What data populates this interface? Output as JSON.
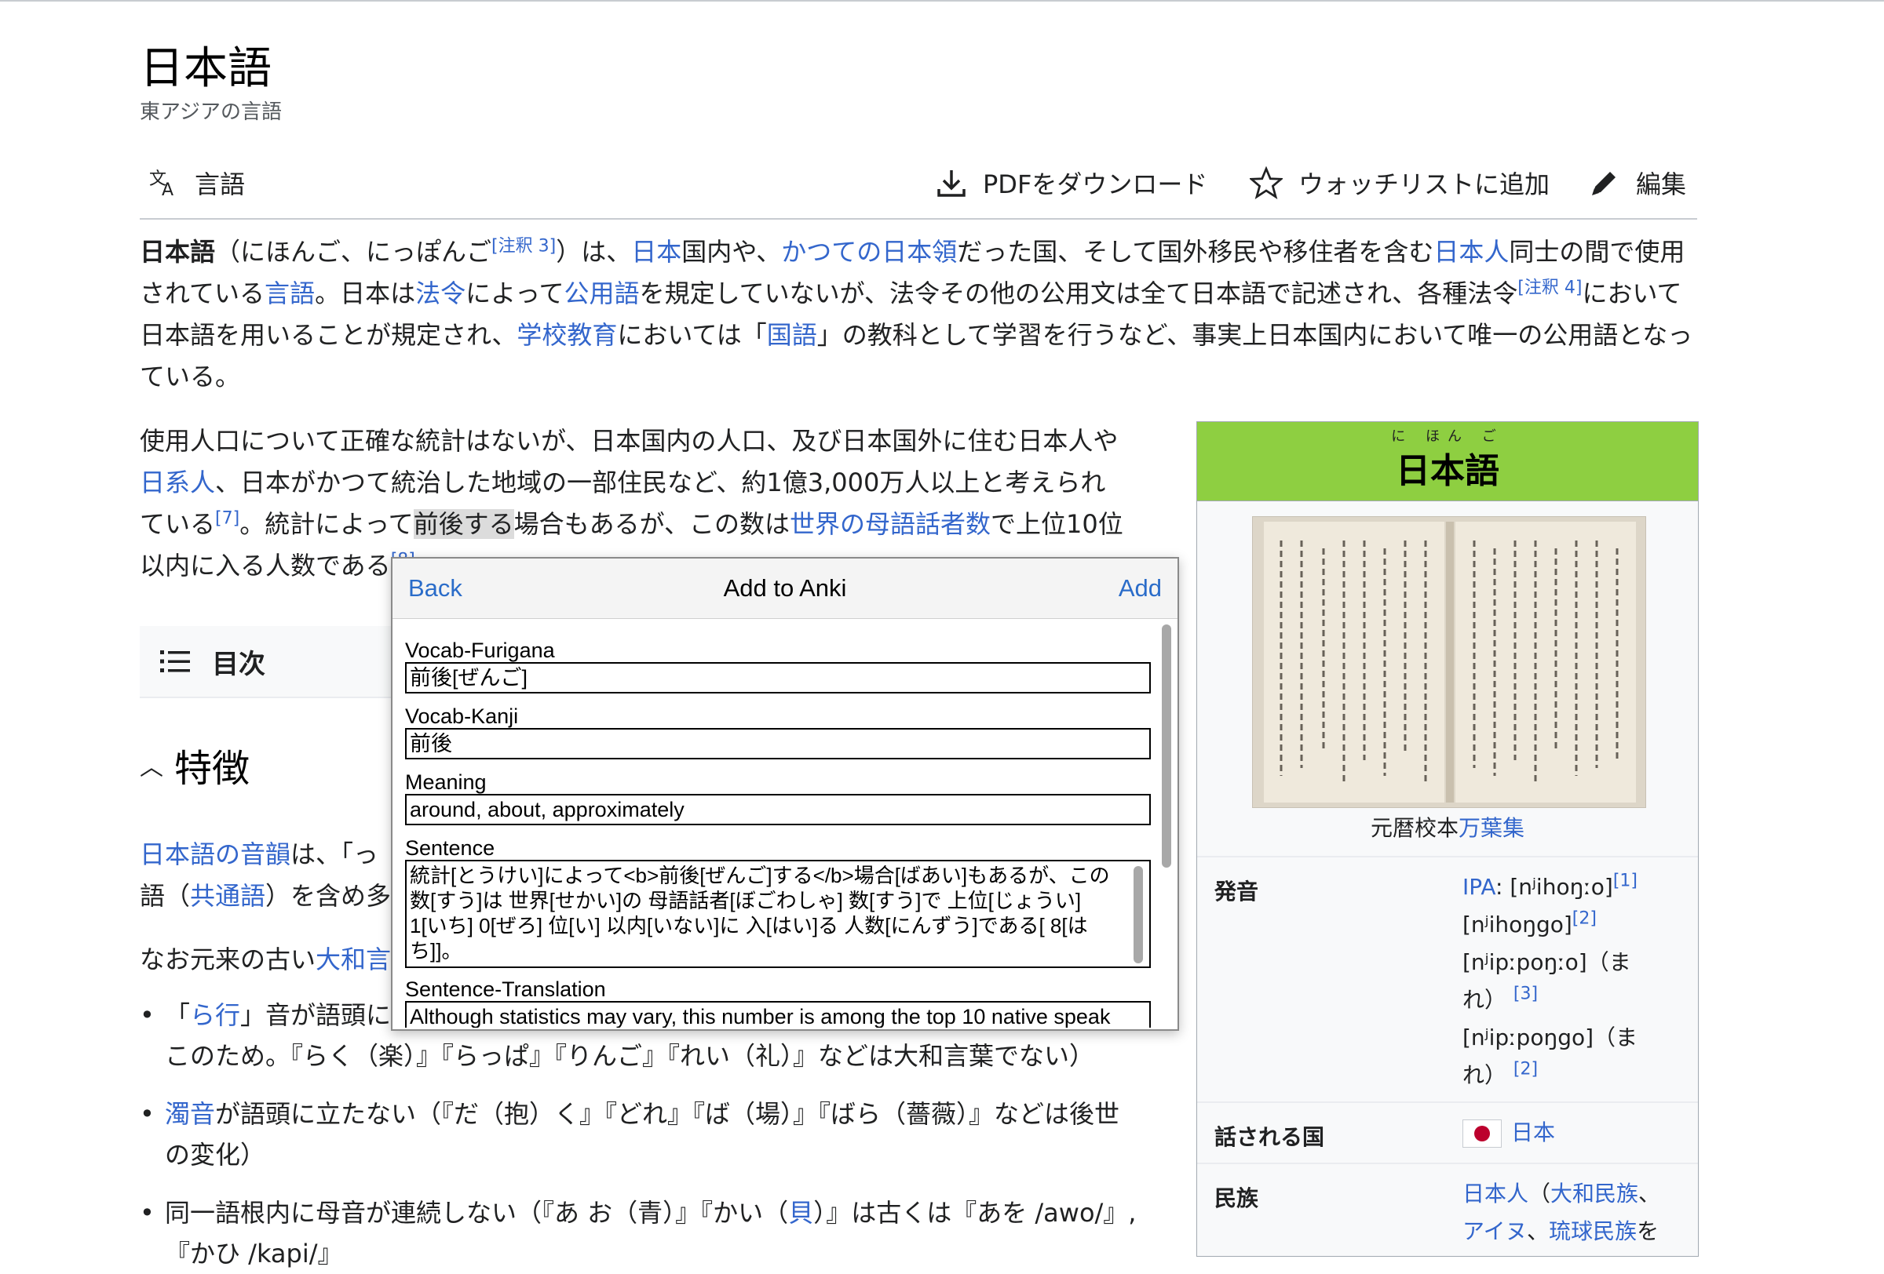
{
  "article": {
    "title": "日本語",
    "subtitle": "東アジアの言語"
  },
  "toolbar": {
    "languages": "言語",
    "download_pdf": "PDFをダウンロード",
    "watchlist": "ウォッチリストに追加",
    "edit": "編集"
  },
  "intro": {
    "s1": "日本語",
    "s2": "（にほんご、にっぽんご",
    "note3": "[注釈 3]",
    "s3": "）は、",
    "l_japan": "日本",
    "s4": "国内や、",
    "l_former": "かつての日本領",
    "s5": "だった国、そして国外移民や移住者を含む",
    "l_japanese_people": "日本人",
    "s6": "同士の間で使用されている",
    "l_language": "言語",
    "s7": "。日本は",
    "l_law": "法令",
    "s8": "によって",
    "l_official": "公用語",
    "s9": "を規定していないが、法令その他の公用文は全て日本語で記述され、各種法令",
    "note4": "[注釈 4]",
    "s10": "において日本語を用いることが規定され、",
    "l_school": "学校教育",
    "s11": "においては「",
    "l_kokugo": "国語",
    "s12": "」の教科として学習を行うなど、事実上日本国内において唯一の公用語となっている。"
  },
  "population": {
    "s1": "使用人口について正確な統計はないが、日本国内の人口、及び日本国外に住む日本人や",
    "l_nikkei": "日系人",
    "s2": "、日本がかつて統治した地域の一部住民など、約1億3,000万人以上と考えられている",
    "ref7": "[7]",
    "s3": "。統計によって",
    "highlight": "前後する",
    "s4": "場合もあるが、この数は",
    "l_native": "世界の母語話者数",
    "s5": "で上位10位以内に入る人数である",
    "ref8": "[8]"
  },
  "toc": {
    "label": "目次"
  },
  "section": {
    "heading": "特徴",
    "p1_l1": "日本語の音韻",
    "p1_s1": "は、「っ",
    "p1_s2": "語（",
    "p1_l2": "共通語",
    "p1_s3": "）を含め多",
    "p2_s1": "なお元来の古い",
    "p2_l1": "大和言"
  },
  "bullets": [
    {
      "pre": "「",
      "link": "ら行",
      "post": "」音が語頭に",
      "line2": "このため。『らく（楽）』『らっぱ』『りんご』『れい（礼）』などは大和言葉でない）"
    },
    {
      "pre": "",
      "link": "濁音",
      "post": "が語頭に立たない（『だ（抱）く』『どれ』『ば（場）』『ばら（薔薇）』などは後世",
      "line2": "の変化）"
    },
    {
      "pre": "同一語根内に母音が連続しない（『あ お（青）』『かい（",
      "link": "貝",
      "post": "）』は古くは『あを /awo/』,",
      "line2": "『かひ /kapi/』"
    }
  ],
  "infobox": {
    "ruby": "に ほん ご",
    "title": "日本語",
    "caption_pre": "元暦校本",
    "caption_link": "万葉集",
    "pron_label": "発音",
    "pron_ipa": "IPA",
    "pron_1": ": [nʲihoŋːo]",
    "pron_ref1": "[1]",
    "pron_2": "[nʲihoŋgo]",
    "pron_ref2": "[2]",
    "pron_3": "[nʲipːpoŋːo]（ま",
    "pron_3b": "れ）",
    "pron_ref3": "[3]",
    "pron_4": "[nʲipːpoŋgo]（ま",
    "pron_4b": "れ）",
    "pron_ref4": "[2]",
    "country_label": "話される国",
    "country_value": "日本",
    "ethnic_label": "民族",
    "ethnic_l1": "日本人",
    "ethnic_s1": "（",
    "ethnic_l2": "大和民族",
    "ethnic_s2": "、",
    "ethnic_l3": "アイヌ",
    "ethnic_s3": "、",
    "ethnic_l4": "琉球民族",
    "ethnic_s4": "を"
  },
  "anki": {
    "back": "Back",
    "title": "Add to Anki",
    "add": "Add",
    "fields": {
      "vocab_furigana_label": "Vocab-Furigana",
      "vocab_furigana_value": "前後[ぜんご]",
      "vocab_kanji_label": "Vocab-Kanji",
      "vocab_kanji_value": "前後",
      "meaning_label": "Meaning",
      "meaning_value": "around, about, approximately",
      "sentence_label": "Sentence",
      "sentence_value": "統計[とうけい]によって<b>前後[ぜんご]する</b>場合[ばあい]もあるが、この 数[すう]は 世界[せかい]の 母語話者[ぼごわしゃ] 数[すう]で 上位[じょうい] 1[いち] 0[ぜろ] 位[い] 以内[いない]に 入[はい]る 人数[にんずう]である[ 8[はち]]。",
      "translation_label": "Sentence-Translation",
      "translation_value": "Although statistics may vary, this number is among the top 10 native speak"
    }
  },
  "colors": {
    "link": "#3366cc",
    "infobox_header": "#8ecf41",
    "anki_link": "#2a6cc9"
  }
}
